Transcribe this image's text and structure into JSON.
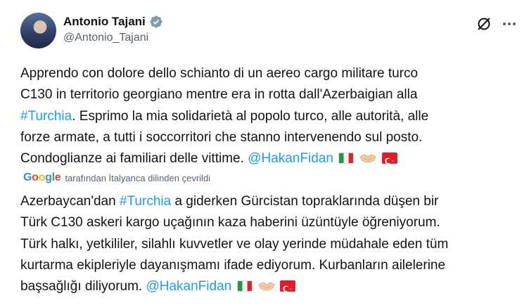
{
  "author": {
    "name": "Antonio Tajani",
    "handle": "@Antonio_Tajani",
    "verified": true
  },
  "icons": {
    "grok": "grok-icon",
    "more": "more-options-icon",
    "verified": "verified-badge-icon"
  },
  "original": {
    "line1": "Apprendo con dolore dello schianto di un aereo cargo militare turco",
    "line2": "C130 in territorio georgiano mentre era in rotta dall'Azerbaigian alla",
    "hashtag": "#Turchia",
    "line3_rest": ". Esprimo la mia solidarietà al popolo turco, alle autorità, alle",
    "line4": "forze armate, a tutti i soccorritori che stanno intervenendo sul posto.",
    "line5": "Condoglianze ai familiari delle vittime. ",
    "mention": "@HakanFidan"
  },
  "translation": {
    "provider": "Google",
    "note": "tarafından İtalyanca dilinden çevrildi"
  },
  "translated": {
    "line1_start": "Azerbaycan'dan ",
    "hashtag": "#Turchia",
    "line1_rest": " a giderken Gürcistan topraklarında düşen bir",
    "line2": "Türk C130 askeri kargo uçağının kaza haberini üzüntüyle öğreniyorum.",
    "line3": "Türk halkı, yetkililer, silahlı kuvvetler ve olay yerinde müdahale eden tüm",
    "line4": "kurtarma ekipleriyle dayanışmamı ifade ediyorum. Kurbanların ailelerine",
    "line5": "başsağlığı diliyorum. ",
    "mention": "@HakanFidan"
  },
  "emoji": [
    "flag-italy",
    "handshake",
    "flag-turkey"
  ],
  "colors": {
    "link": "#1d9bf0",
    "text": "#0f1419",
    "secondary": "#536471"
  }
}
